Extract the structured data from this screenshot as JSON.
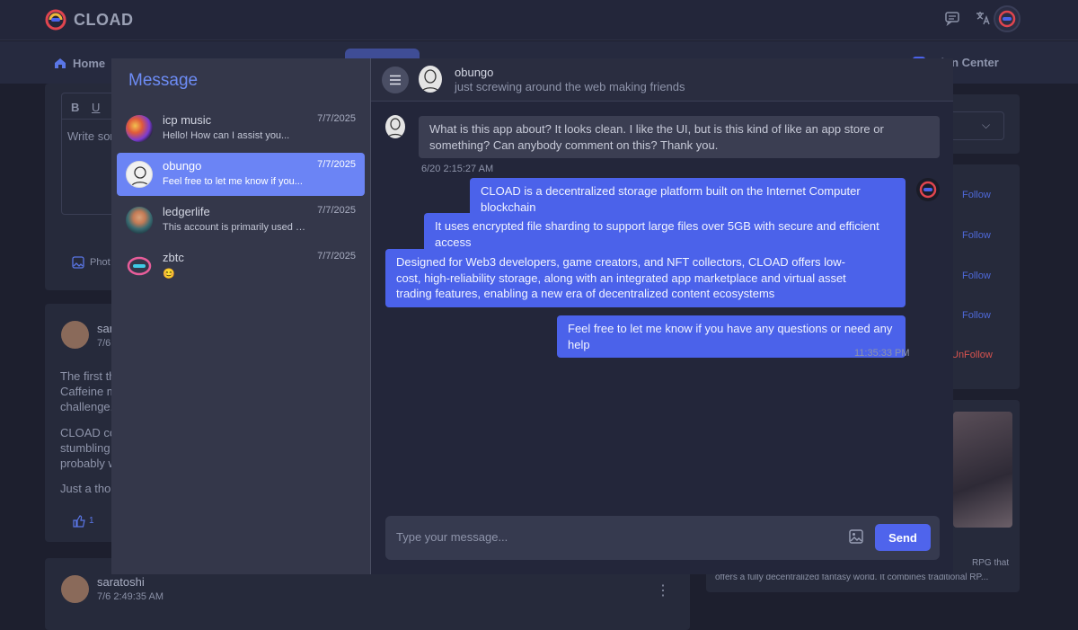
{
  "app": {
    "name": "CLOAD"
  },
  "nav": {
    "home": "Home",
    "notification_center": "ation Center"
  },
  "background": {
    "editor_placeholder": "Write sor",
    "photo_label": "Phot",
    "post1_author": "sara",
    "post1_time": "7/6",
    "post1_lines": [
      "The first th",
      "Caffeine m",
      "challenge.",
      "CLOAD cou",
      "stumbling",
      "probably w",
      "Just a thou"
    ],
    "post1_likes": "1",
    "post2_author": "saratoshi",
    "post2_time": "7/6 2:49:35 AM",
    "follow_labels": [
      "Follow",
      "Follow",
      "Follow",
      "Follow",
      "UnFollow"
    ],
    "card_text_1": "RPG that",
    "card_text_2": "offers a fully decentralized fantasy world. It combines traditional RP..."
  },
  "messages_panel": {
    "title": "Message",
    "conversations": [
      {
        "name": "icp music",
        "date": "7/7/2025",
        "preview": "Hello! How can I assist you..."
      },
      {
        "name": "obungo",
        "date": "7/7/2025",
        "preview": "Feel free to let me know if you..."
      },
      {
        "name": "ledgerlife",
        "date": "7/7/2025",
        "preview": "This account is primarily used f..."
      },
      {
        "name": "zbtc",
        "date": "7/7/2025",
        "preview": "😊"
      }
    ]
  },
  "chat": {
    "name": "obungo",
    "status": "just screwing around the web making friends",
    "messages": [
      {
        "text": "What is this app about? It looks clean. I like the UI, but is this kind of like an app store or something? Can anybody comment on this? Thank you."
      },
      {
        "text": "CLOAD is a decentralized storage platform built on the Internet Computer blockchain"
      },
      {
        "text": "It uses encrypted file sharding to support large files over 5GB with secure and efficient access"
      },
      {
        "text": "Designed for Web3 developers, game creators, and NFT collectors, CLOAD offers low-cost, high-reliability storage, along with an integrated app marketplace and virtual asset trading features, enabling a new era of decentralized content ecosystems"
      },
      {
        "text": "Feel free to let me know if you have any questions or need any help"
      }
    ],
    "timestamp_in": "6/20 2:15:27 AM",
    "timestamp_out": "11:35:33 PM",
    "input_placeholder": "Type your message...",
    "send_label": "Send"
  },
  "colors": {
    "accent": "#4b62ea",
    "active_conv": "#6b84f5",
    "title": "#6d8cf5"
  }
}
